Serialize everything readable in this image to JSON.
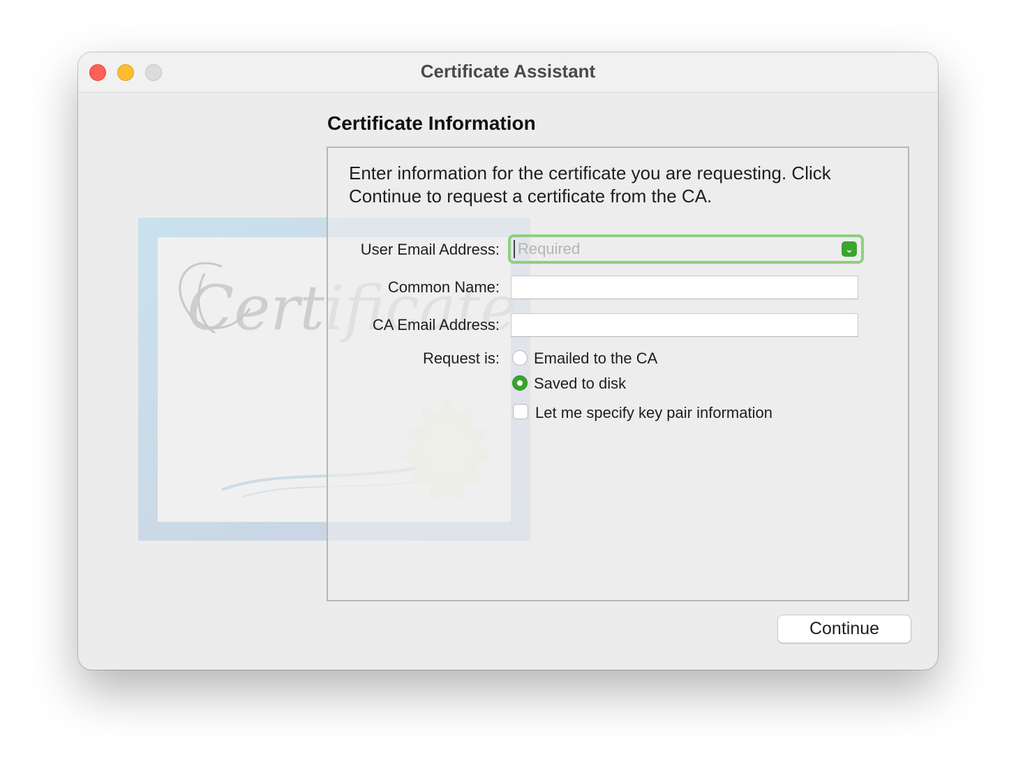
{
  "window": {
    "title": "Certificate Assistant"
  },
  "traffic_lights": {
    "close_color": "#fe5f57",
    "minimize_color": "#febc2e",
    "zoom_color": "#dcdcdc"
  },
  "section": {
    "heading": "Certificate Information",
    "intro": "Enter information for the certificate you are requesting. Click Continue to request a certificate from the CA."
  },
  "illustration": {
    "icon": "certificate-illustration",
    "script_word": "Certificate"
  },
  "form": {
    "user_email": {
      "label": "User Email Address:",
      "value": "",
      "placeholder": "Required",
      "dropdown_icon": "chevron-down-icon"
    },
    "common_name": {
      "label": "Common Name:",
      "value": ""
    },
    "ca_email": {
      "label": "CA Email Address:",
      "value": ""
    },
    "request": {
      "label": "Request is:",
      "options": [
        {
          "label": "Emailed to the CA",
          "selected": false
        },
        {
          "label": "Saved to disk",
          "selected": true
        }
      ]
    },
    "key_pair_checkbox": {
      "label": "Let me specify key pair information",
      "checked": false
    }
  },
  "footer": {
    "continue_label": "Continue"
  },
  "colors": {
    "accent": "#36a52c",
    "focus_ring": "#8fcf82",
    "window_bg": "#ececec"
  }
}
